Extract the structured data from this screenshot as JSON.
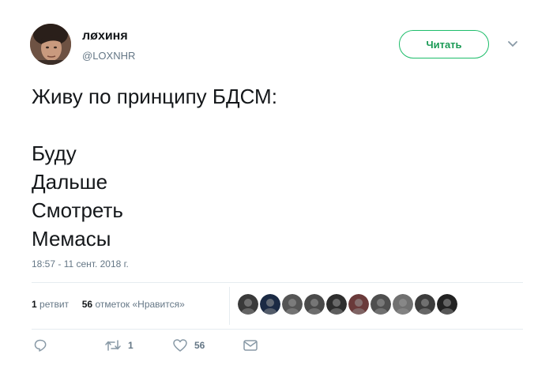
{
  "user": {
    "display_name": "лøхиня",
    "handle": "@LOXNHR",
    "avatar_icon": "user-avatar-photo"
  },
  "header": {
    "follow_label": "Читать",
    "more_icon": "chevron-down-icon"
  },
  "tweet": {
    "lines": [
      "Живу по принципу БДСМ:",
      "",
      "Буду",
      "Дальше",
      "Смотреть",
      "Мемасы"
    ],
    "timestamp": "18:57 - 11 сент. 2018 г."
  },
  "stats": {
    "retweets_count": "1",
    "retweets_label": "ретвит",
    "likes_count": "56",
    "likes_label": "отметок «Нравится»",
    "liker_avatar_count": 10
  },
  "actions": {
    "reply_icon": "reply-icon",
    "retweet_icon": "retweet-icon",
    "retweet_count": "1",
    "like_icon": "heart-icon",
    "like_count": "56",
    "dm_icon": "envelope-icon"
  },
  "colors": {
    "follow_border": "#1dbd6a",
    "follow_text": "#1a9a55",
    "secondary_text": "#657786",
    "primary_text": "#14171a",
    "divider": "#e6ecf0"
  }
}
